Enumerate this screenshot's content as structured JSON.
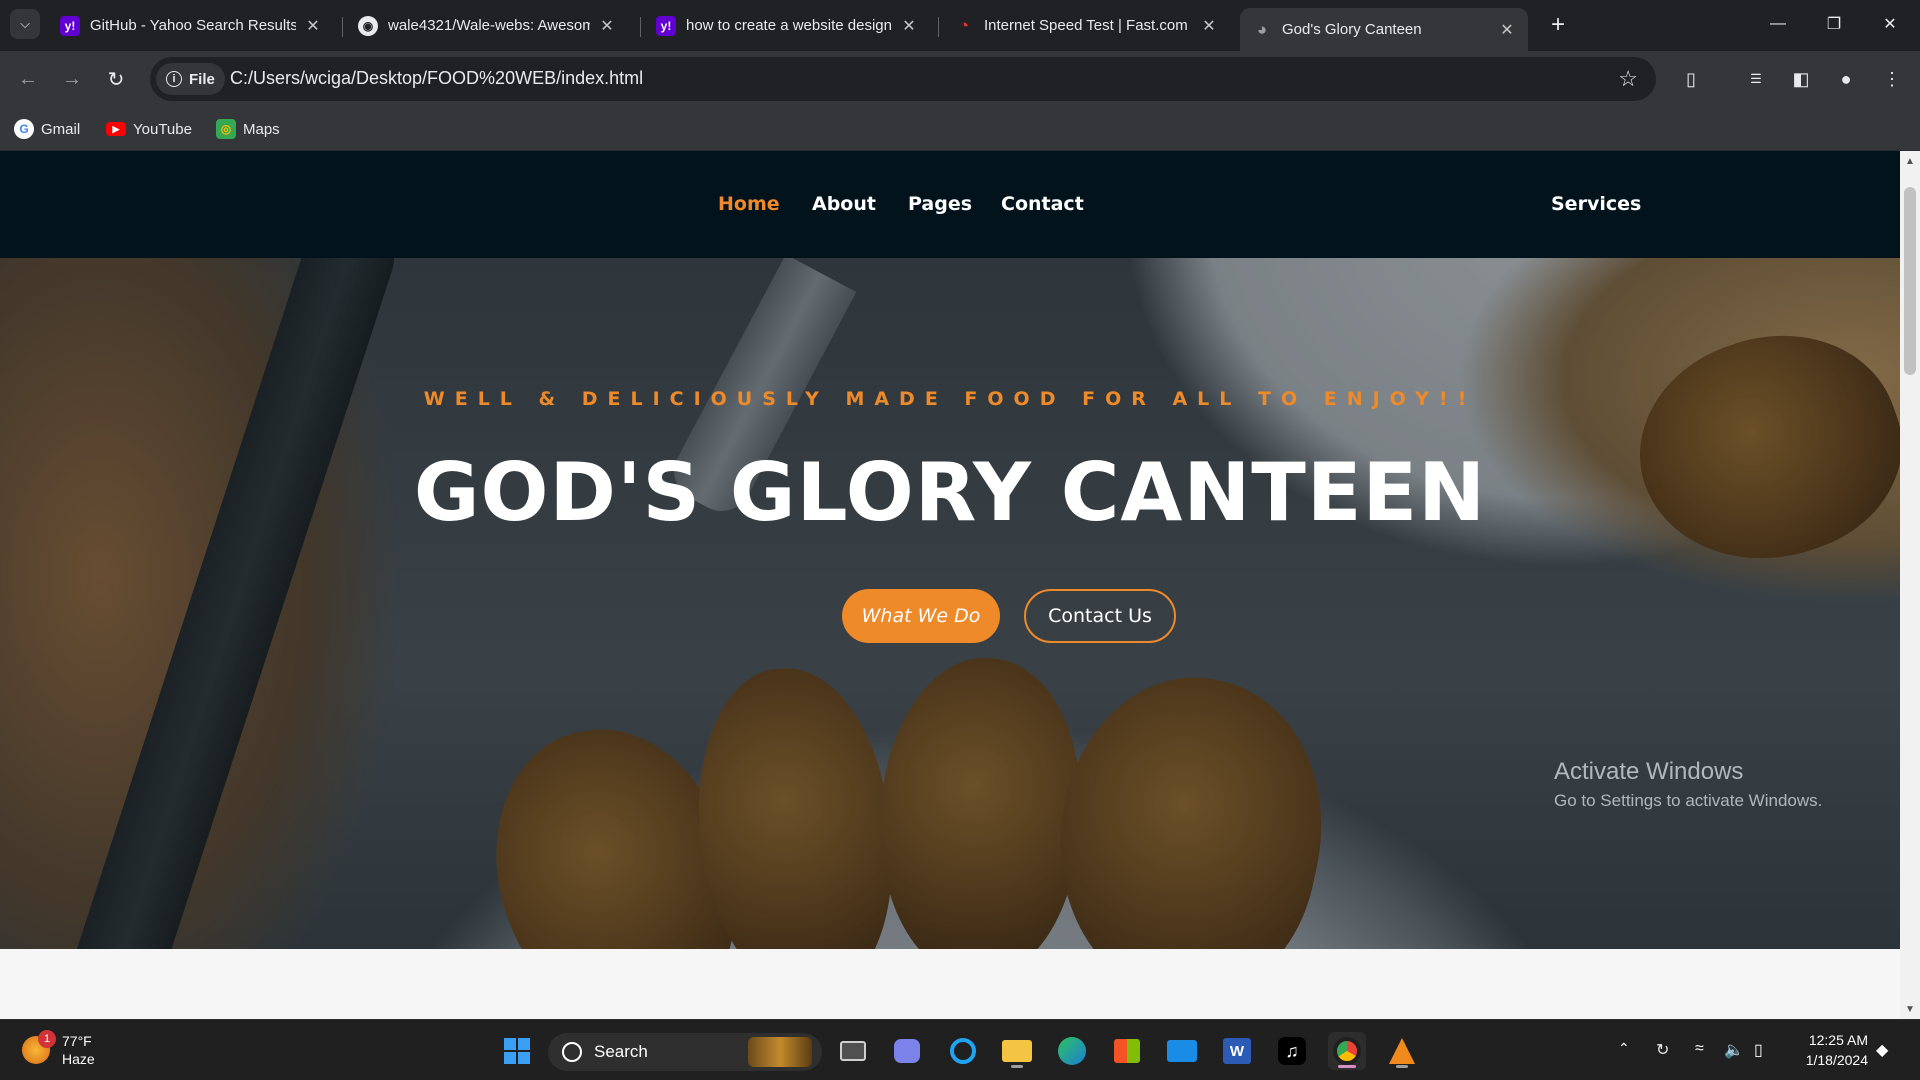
{
  "browser": {
    "tabs": [
      {
        "title": "GitHub - Yahoo Search Results",
        "favicon": "yahoo-icon",
        "active": false
      },
      {
        "title": "wale4321/Wale-webs: Awesome",
        "favicon": "github-icon",
        "active": false
      },
      {
        "title": "how to create a website design",
        "favicon": "yahoo-icon",
        "active": false
      },
      {
        "title": "Internet Speed Test | Fast.com",
        "favicon": "fast-icon",
        "active": false
      },
      {
        "title": "God's Glory Canteen",
        "favicon": "globe-icon",
        "active": true
      }
    ],
    "address": {
      "chip_label": "File",
      "url": "C:/Users/wciga/Desktop/FOOD%20WEB/index.html"
    },
    "bookmarks": [
      {
        "label": "Gmail",
        "icon": "google-icon"
      },
      {
        "label": "YouTube",
        "icon": "youtube-icon"
      },
      {
        "label": "Maps",
        "icon": "maps-icon"
      }
    ]
  },
  "site": {
    "nav": {
      "home": "Home",
      "about": "About",
      "pages": "Pages",
      "contact": "Contact",
      "services": "Services"
    },
    "hero": {
      "tagline": "WELL & DELICIOUSLY MADE FOOD FOR ALL TO ENJOY!!",
      "title": "GOD'S GLORY CANTEEN",
      "primary_button": "What We Do",
      "secondary_button": "Contact Us"
    },
    "accent_color": "#ee8a2a",
    "nav_background": "#03131c"
  },
  "overlay": {
    "activate_title": "Activate Windows",
    "activate_sub": "Go to Settings to activate Windows."
  },
  "taskbar": {
    "weather": {
      "temp": "77°F",
      "condition": "Haze",
      "badge": "1"
    },
    "search_label": "Search",
    "time": "12:25 AM",
    "date": "1/18/2024"
  }
}
